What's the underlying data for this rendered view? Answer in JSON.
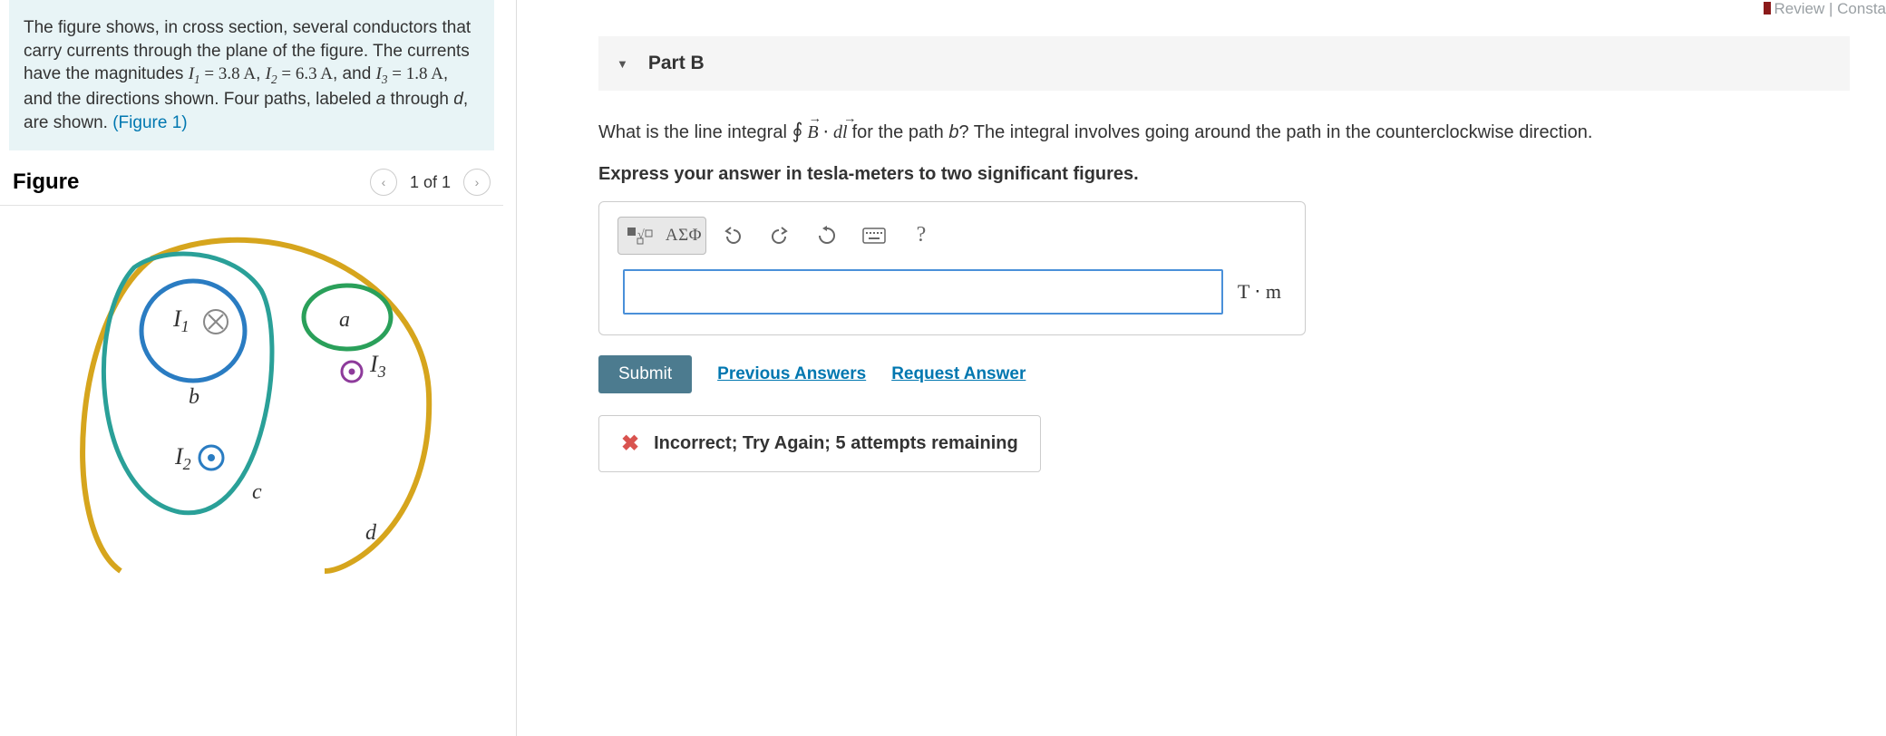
{
  "problem": {
    "intro_pre": "The figure shows, in cross section, several conductors that carry currents through the plane of the figure. The currents have the magnitudes ",
    "i1_sym": "I",
    "i1_sub": "1",
    "i1_eq": " = 3.8 A",
    "sep12": ", ",
    "i2_sym": "I",
    "i2_sub": "2",
    "i2_eq": " = 6.3 A",
    "sep23": ", and ",
    "i3_sym": "I",
    "i3_sub": "3",
    "i3_eq": " = 1.8 A",
    "tail": ", and the directions shown. Four paths, labeled ",
    "a": "a",
    "thru": " through ",
    "d": "d",
    "tail2": ", are shown. ",
    "figlink": "(Figure 1)"
  },
  "figure": {
    "title": "Figure",
    "counter": "1 of 1",
    "labels": {
      "I1": "I",
      "I1s": "1",
      "I2": "I",
      "I2s": "2",
      "I3": "I",
      "I3s": "3",
      "a": "a",
      "b": "b",
      "c": "c",
      "d": "d"
    }
  },
  "topright": "Review | Consta",
  "part": {
    "label": "Part B",
    "question_pre": "What is the line integral ",
    "question_mid": " for the path ",
    "path": "b",
    "question_post": "? The integral involves going around the path in the counterclockwise direction.",
    "instruction": "Express your answer in tesla-meters to two significant figures."
  },
  "toolbar": {
    "templates": "▭√▭",
    "greek": "ΑΣΦ"
  },
  "answer": {
    "value": "",
    "unit": "T ⋅ m"
  },
  "actions": {
    "submit": "Submit",
    "prev": "Previous Answers",
    "req": "Request Answer"
  },
  "feedback": "Incorrect; Try Again; 5 attempts remaining"
}
